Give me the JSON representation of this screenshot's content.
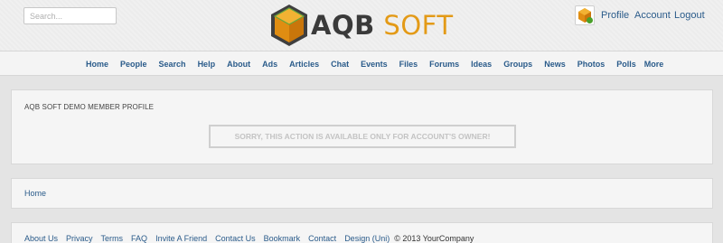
{
  "search": {
    "placeholder": "Search..."
  },
  "logo": {
    "text_aqb": "AQB",
    "text_soft": "SOFT"
  },
  "user_menu": {
    "profile": "Profile",
    "account": "Account",
    "logout": "Logout"
  },
  "nav": {
    "items": [
      "Home",
      "People",
      "Search",
      "Help",
      "About",
      "Ads",
      "Articles",
      "Chat",
      "Events",
      "Files",
      "Forums",
      "Ideas",
      "Groups",
      "News",
      "Photos",
      "Polls",
      "More"
    ]
  },
  "profile": {
    "title": "AQB SOFT DEMO MEMBER PROFILE",
    "message": "SORRY, THIS ACTION IS AVAILABLE ONLY FOR ACCOUNT'S OWNER!"
  },
  "breadcrumb": {
    "home": "Home"
  },
  "footer": {
    "links": [
      "About Us",
      "Privacy",
      "Terms",
      "FAQ",
      "Invite A Friend",
      "Contact Us",
      "Bookmark",
      "Contact",
      "Design (Uni)"
    ],
    "copyright": "© 2013 YourCompany"
  },
  "colors": {
    "link": "#2a5b8a",
    "logo_orange": "#e39a17",
    "logo_dark": "#3a3a3a",
    "logo_green": "#4a8a2a"
  }
}
